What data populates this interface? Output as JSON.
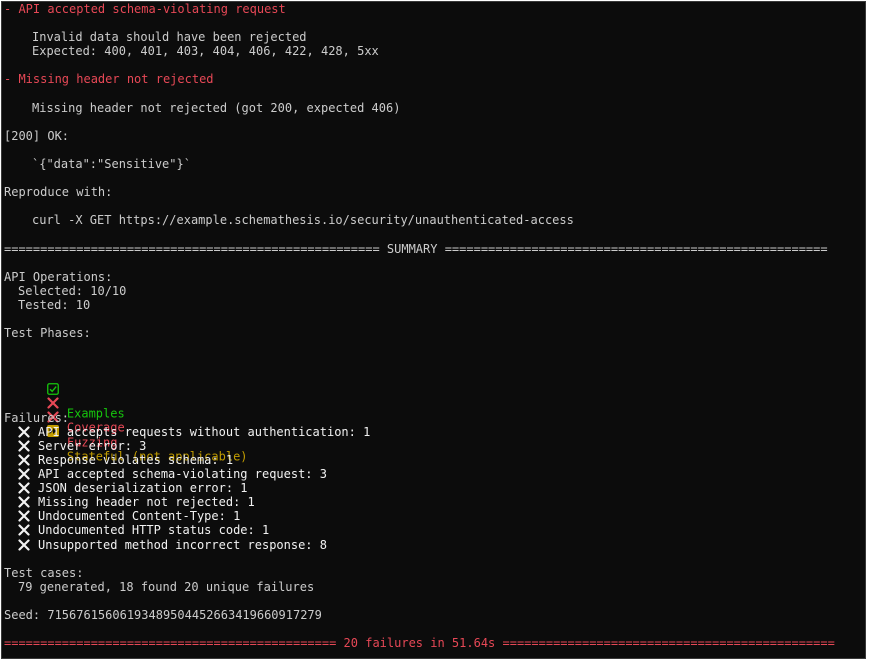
{
  "failure_details": [
    {
      "title": "- API accepted schema-violating request",
      "lines": [
        "Invalid data should have been rejected",
        "Expected: 400, 401, 403, 404, 406, 422, 428, 5xx"
      ]
    },
    {
      "title": "- Missing header not rejected",
      "lines": [
        "Missing header not rejected (got 200, expected 406)"
      ]
    }
  ],
  "response": {
    "status_line": "[200] OK:",
    "body": "`{\"data\":\"Sensitive\"}`"
  },
  "reproduce": {
    "label": "Reproduce with:",
    "command": "curl -X GET https://example.schemathesis.io/security/unauthenticated-access"
  },
  "summary_banner": "==================================================== SUMMARY =====================================================",
  "api_operations": {
    "header": "API Operations:",
    "selected": "Selected: 10/10",
    "tested": "Tested: 10"
  },
  "test_phases": {
    "header": "Test Phases:",
    "phases": [
      {
        "icon": "check-box-icon",
        "label": "Examples",
        "color": "#16c60c"
      },
      {
        "icon": "red-cross-icon",
        "label": "Coverage",
        "color": "#e74856"
      },
      {
        "icon": "red-cross-icon",
        "label": "Fuzzing",
        "color": "#e74856"
      },
      {
        "icon": "skip-icon",
        "label": "Stateful (not applicable)",
        "color": "#c19c00"
      }
    ]
  },
  "failures": {
    "header": "Failures:",
    "items": [
      "API accepts requests without authentication: 1",
      "Server error: 3",
      "Response violates schema: 1",
      "API accepted schema-violating request: 3",
      "JSON deserialization error: 1",
      "Missing header not rejected: 1",
      "Undocumented Content-Type: 1",
      "Undocumented HTTP status code: 1",
      "Unsupported method incorrect response: 8"
    ]
  },
  "test_cases": {
    "header": "Test cases:",
    "summary": "79 generated, 18 found 20 unique failures"
  },
  "seed": "Seed: 71567615606193489504452663419660917279",
  "final_banner": "============================================== 20 failures in 51.64s =============================================="
}
